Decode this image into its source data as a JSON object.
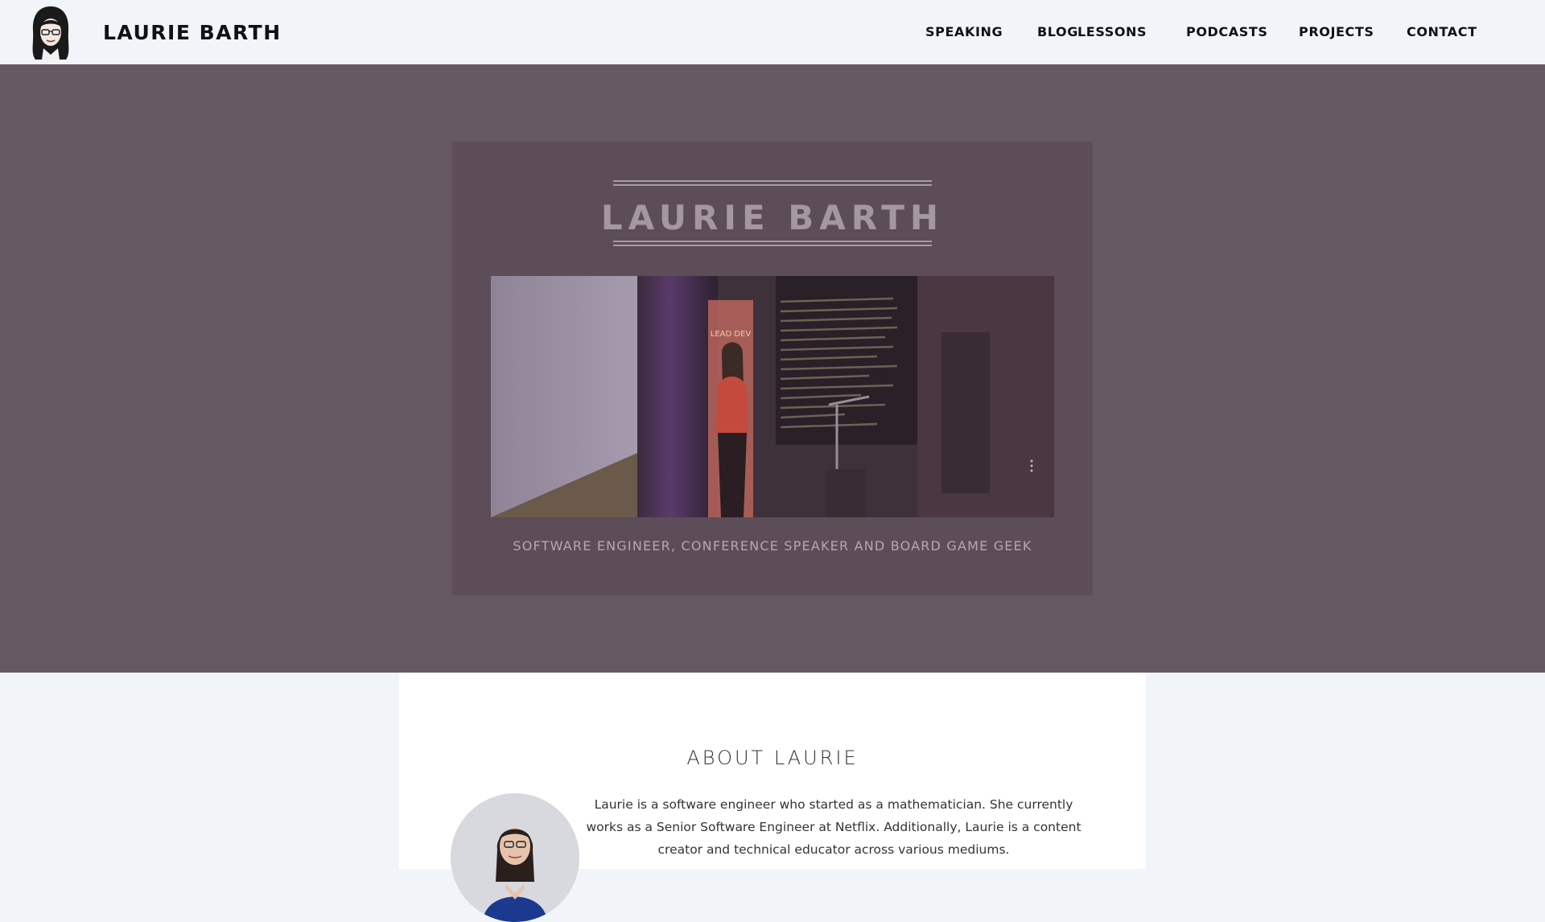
{
  "header": {
    "site_title": "LAURIE BARTH",
    "nav": [
      {
        "label": "SPEAKING"
      },
      {
        "label": "BLOG"
      },
      {
        "label": "LESSONS"
      },
      {
        "label": "PODCASTS"
      },
      {
        "label": "PROJECTS"
      },
      {
        "label": "CONTACT"
      }
    ]
  },
  "hero": {
    "title": "LAURIE BARTH",
    "tagline": "SOFTWARE ENGINEER, CONFERENCE SPEAKER AND BOARD GAME GEEK",
    "banner_text": "LEAD DEV"
  },
  "about": {
    "heading": "ABOUT LAURIE",
    "text": "Laurie is a software engineer who started as a mathematician. She currently works as a Senior Software Engineer at Netflix. Additionally, Laurie is a content creator and technical educator across various mediums."
  },
  "colors": {
    "header_bg": "#f1f5fa",
    "hero_bg": "#655863",
    "card_bg": "#5d4d59",
    "title_color": "#a497a3"
  }
}
